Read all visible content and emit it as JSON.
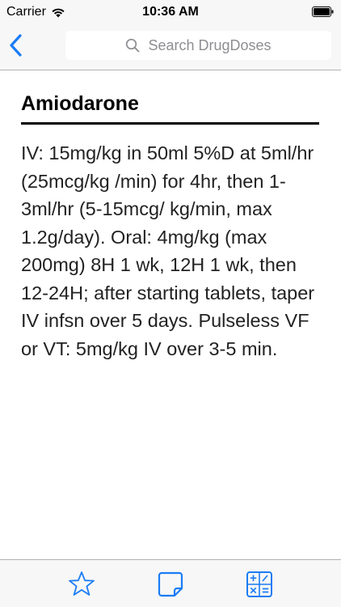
{
  "status_bar": {
    "carrier": "Carrier",
    "time": "10:36 AM",
    "wifi_icon": "wifi-icon",
    "battery_icon": "battery-icon"
  },
  "nav": {
    "back_icon": "chevron-left-icon",
    "search_placeholder": "Search DrugDoses",
    "search_icon": "search-icon"
  },
  "drug": {
    "name": "Amiodarone",
    "dosing": "IV: 15mg/kg in 50ml 5%D at 5ml/hr (25mcg/kg /min) for 4hr, then 1-3ml/hr (5-15mcg/ kg/min, max 1.2g/day). Oral: 4mg/kg (max 200mg) 8H 1 wk, 12H 1 wk, then 12-24H; after starting tablets, taper IV infsn over 5 days. Pulseless VF or VT: 5mg/kg IV over 3-5 min."
  },
  "tab_bar": {
    "tabs": [
      {
        "icon": "star-icon"
      },
      {
        "icon": "note-icon"
      },
      {
        "icon": "calculator-icon"
      }
    ]
  },
  "colors": {
    "accent": "#1a7cf5",
    "bar_background": "#f7f7f7",
    "placeholder": "#8e8e93"
  }
}
